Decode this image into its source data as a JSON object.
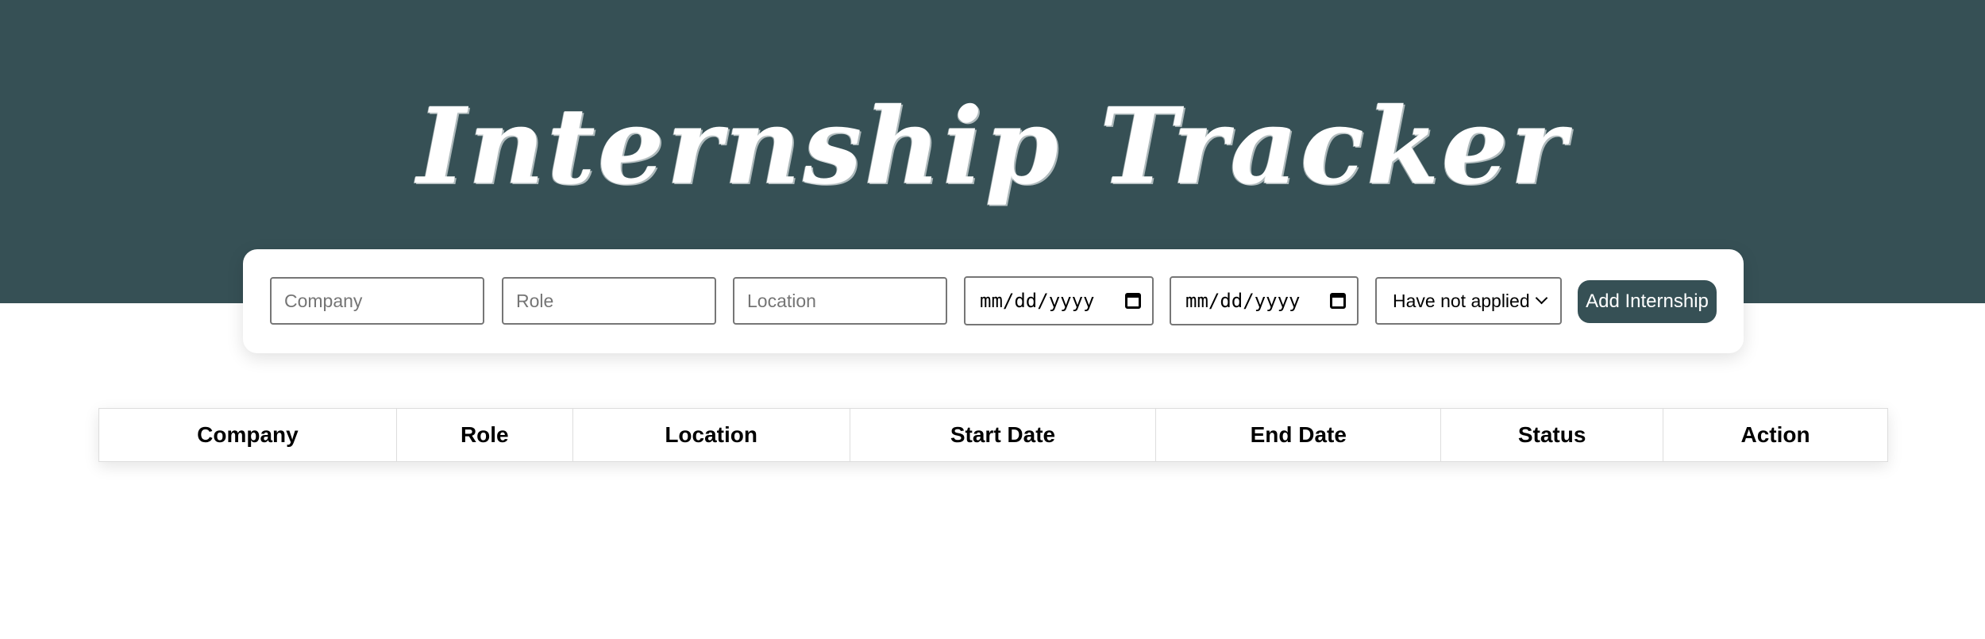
{
  "header": {
    "title": "Internship Tracker",
    "background_color": "#365055"
  },
  "form": {
    "company_placeholder": "Company",
    "role_placeholder": "Role",
    "location_placeholder": "Location",
    "start_date_text": "mm/dd/yyyy",
    "end_date_text": "mm/dd/yyyy",
    "status_selected": "Have not applied",
    "add_button_label": "Add Internship",
    "calendar_icon": "calendar-icon",
    "dropdown_icon": "chevron-down-icon"
  },
  "table": {
    "columns": [
      "Company",
      "Role",
      "Location",
      "Start Date",
      "End Date",
      "Status",
      "Action"
    ],
    "rows": []
  }
}
